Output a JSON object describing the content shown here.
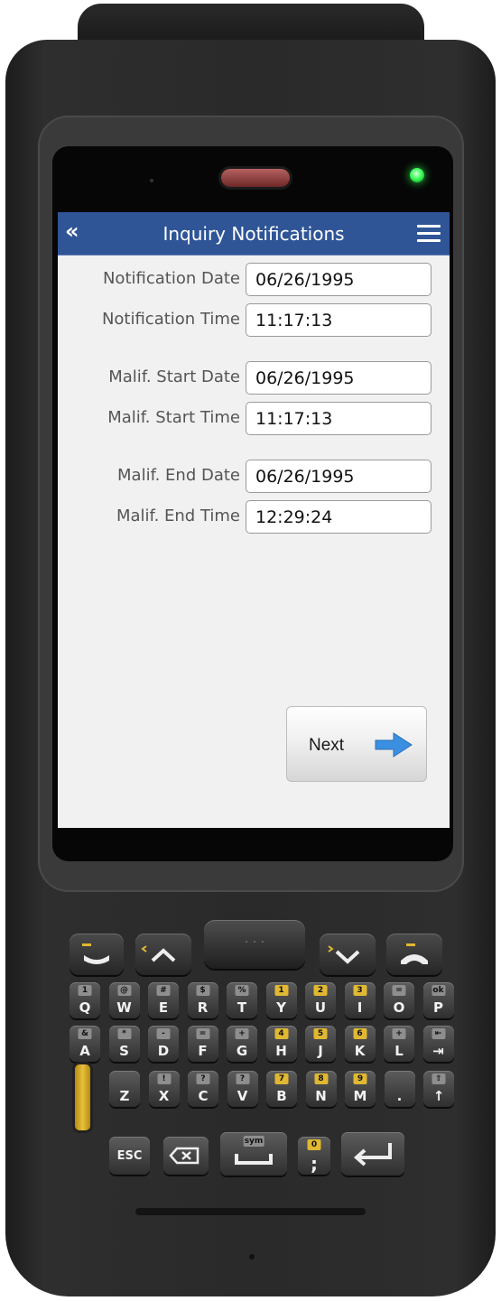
{
  "header": {
    "back_icon": "double-chevron-left-icon",
    "back_glyph": "«",
    "title": "Inquiry Notifications",
    "menu_icon": "hamburger-menu-icon"
  },
  "fields": [
    {
      "label": "Notification Date",
      "value": "06/26/1995"
    },
    {
      "label": "Notification Time",
      "value": "11:17:13"
    },
    {
      "label": "Malif. Start Date",
      "value": "06/26/1995"
    },
    {
      "label": "Malif. Start Time",
      "value": "11:17:13"
    },
    {
      "label": "Malif. End Date",
      "value": "06/26/1995"
    },
    {
      "label": "Malif. End Time",
      "value": "12:29:24"
    }
  ],
  "next_button": {
    "label": "Next",
    "icon": "arrow-right-icon"
  },
  "keypad": {
    "scan_key_label": "· · ·",
    "row1": [
      {
        "main": "Q",
        "sub": "1"
      },
      {
        "main": "W",
        "sub": "@"
      },
      {
        "main": "E",
        "sub": "#"
      },
      {
        "main": "R",
        "sub": "$"
      },
      {
        "main": "T",
        "sub": "%"
      },
      {
        "main": "Y",
        "sub": "1"
      },
      {
        "main": "U",
        "sub": "2"
      },
      {
        "main": "I",
        "sub": "3"
      },
      {
        "main": "O",
        "sub": "="
      },
      {
        "main": "P",
        "sub": "ok"
      }
    ],
    "row2": [
      {
        "main": "A",
        "sub": "&"
      },
      {
        "main": "S",
        "sub": "*"
      },
      {
        "main": "D",
        "sub": "-"
      },
      {
        "main": "F",
        "sub": "="
      },
      {
        "main": "G",
        "sub": "+"
      },
      {
        "main": "H",
        "sub": "4"
      },
      {
        "main": "J",
        "sub": "5"
      },
      {
        "main": "K",
        "sub": "6"
      },
      {
        "main": "L",
        "sub": "+"
      },
      {
        "main": "⇥",
        "sub": "⇤"
      }
    ],
    "row3": [
      {
        "main": "Z",
        "sub": ""
      },
      {
        "main": "X",
        "sub": "!"
      },
      {
        "main": "C",
        "sub": "?"
      },
      {
        "main": "V",
        "sub": "?"
      },
      {
        "main": "B",
        "sub": "7"
      },
      {
        "main": "N",
        "sub": "8"
      },
      {
        "main": "M",
        "sub": "9"
      },
      {
        "main": ".",
        "sub": ""
      },
      {
        "main": "↑",
        "sub": "⇧"
      }
    ],
    "esc_label": "ESC",
    "sym_label": "sym",
    "semicolon_main": ";",
    "semicolon_sub": "0"
  },
  "colors": {
    "title_bar": "#2f5597",
    "screen_bg": "#f1f1f1",
    "led": "#3cff5a",
    "earpiece": "#a34a4a",
    "arrow": "#3b8fe0",
    "yellow_keys": "#e0b832"
  }
}
